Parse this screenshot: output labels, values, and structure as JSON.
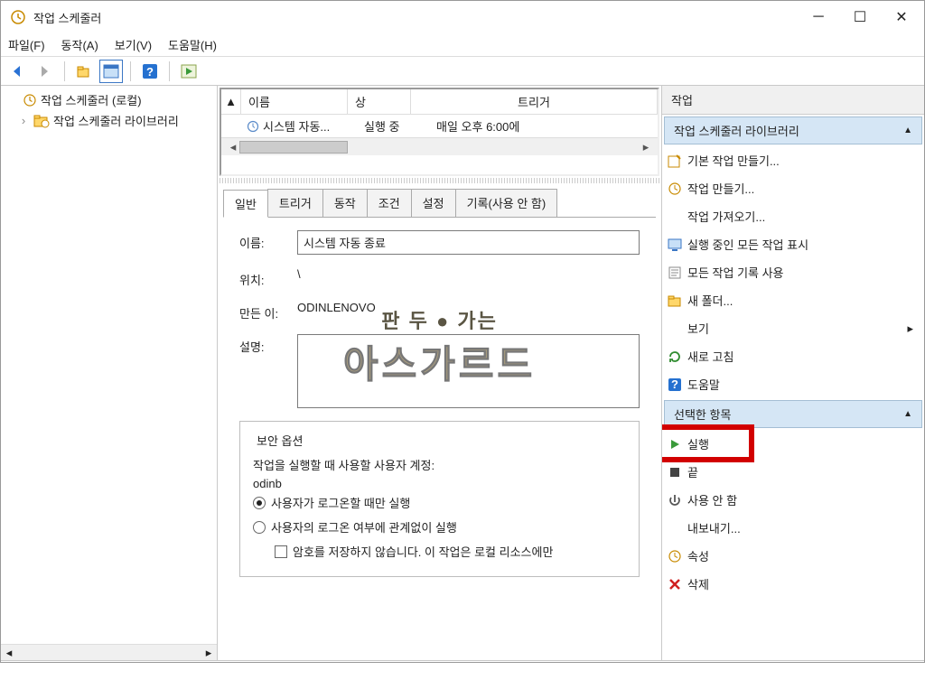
{
  "window": {
    "title": "작업 스케줄러"
  },
  "menu": {
    "file": "파일(F)",
    "action": "동작(A)",
    "view": "보기(V)",
    "help": "도움말(H)"
  },
  "tree": {
    "root": "작업 스케줄러 (로컬)",
    "library": "작업 스케줄러 라이브러리"
  },
  "list": {
    "sort_icon": "▲",
    "col_name": "이름",
    "col_status": "상",
    "col_trigger": "트리거",
    "row1_name": "시스템 자동...",
    "row1_status": "실행 중",
    "row1_trigger": "매일 오후 6:00에"
  },
  "tabs": {
    "general": "일반",
    "triggers": "트리거",
    "actions": "동작",
    "conditions": "조건",
    "settings": "설정",
    "history": "기록(사용 안 함)"
  },
  "general": {
    "name_lbl": "이름:",
    "name_val": "시스템 자동 종료",
    "location_lbl": "위치:",
    "location_val": "\\",
    "author_lbl": "만든 이:",
    "author_val": "ODINLENOVO",
    "desc_lbl": "설명:",
    "sec_title": "보안 옵션",
    "sec_user_lbl": "작업을 실행할 때 사용할 사용자 계정:",
    "sec_user": "odinb",
    "radio_logged_on": "사용자가 로그온할 때만 실행",
    "radio_any": "사용자의 로그온 여부에 관계없이 실행",
    "chk_nopwd": "암호를 저장하지 않습니다. 이 작업은 로컬 리소스에만"
  },
  "actions": {
    "pane_title": "작업",
    "section1": "작업 스케줄러 라이브러리",
    "create_basic": "기본 작업 만들기...",
    "create_task": "작업 만들기...",
    "import": "작업 가져오기...",
    "show_running": "실행 중인 모든 작업 표시",
    "enable_history": "모든 작업 기록 사용",
    "new_folder": "새 폴더...",
    "view": "보기",
    "refresh": "새로 고침",
    "help": "도움말",
    "section2": "선택한 항목",
    "run": "실행",
    "end": "끝",
    "disable": "사용 안 함",
    "export": "내보내기...",
    "properties": "속성",
    "delete": "삭제"
  },
  "watermark": {
    "line1": "판 두 ● 가는",
    "line2": "아스가르드"
  }
}
